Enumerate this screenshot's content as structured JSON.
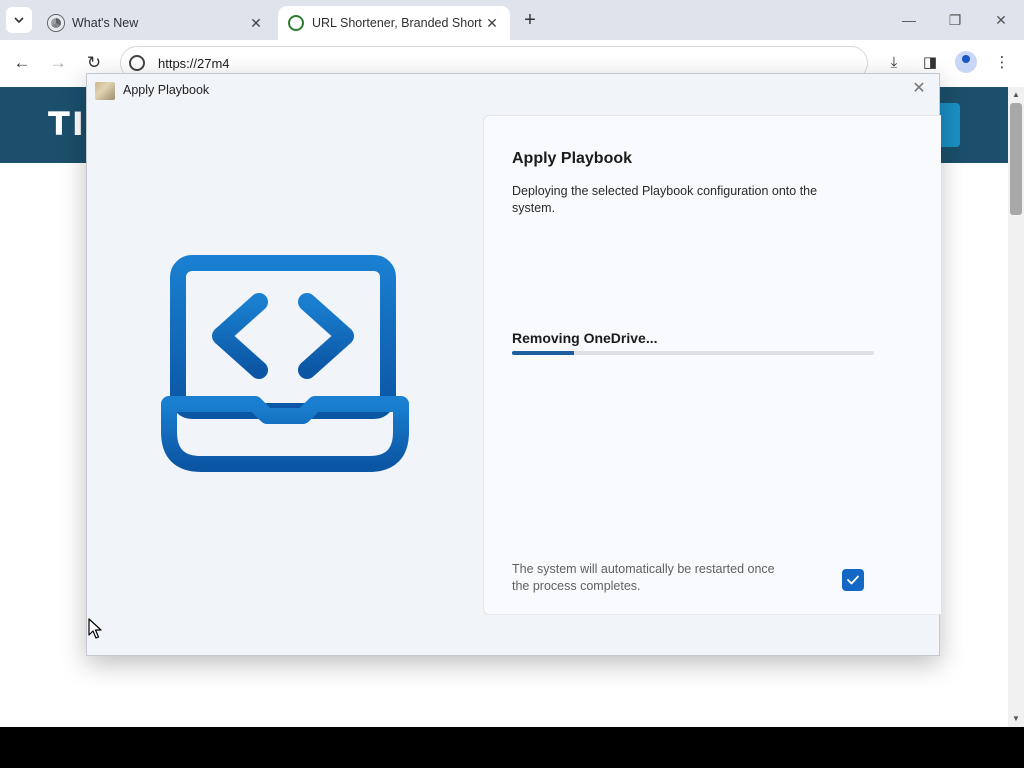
{
  "browser": {
    "tabs": [
      {
        "title": "What's New",
        "active": false
      },
      {
        "title": "URL Shortener, Branded Short L",
        "active": true
      }
    ],
    "url": "https://27m4"
  },
  "website": {
    "logo_text": "TI",
    "header_color": "#1b4f6b"
  },
  "dialog": {
    "title": "Apply Playbook",
    "heading": "Apply Playbook",
    "description": "Deploying the selected Playbook configuration onto the system.",
    "status": "Removing OneDrive...",
    "progress_fraction": 0.17,
    "restart_note": "The system will automatically be restarted once the process completes.",
    "restart_checked": true,
    "illustration_icon": "laptop-code-icon",
    "accent_color": "#1268c4"
  }
}
